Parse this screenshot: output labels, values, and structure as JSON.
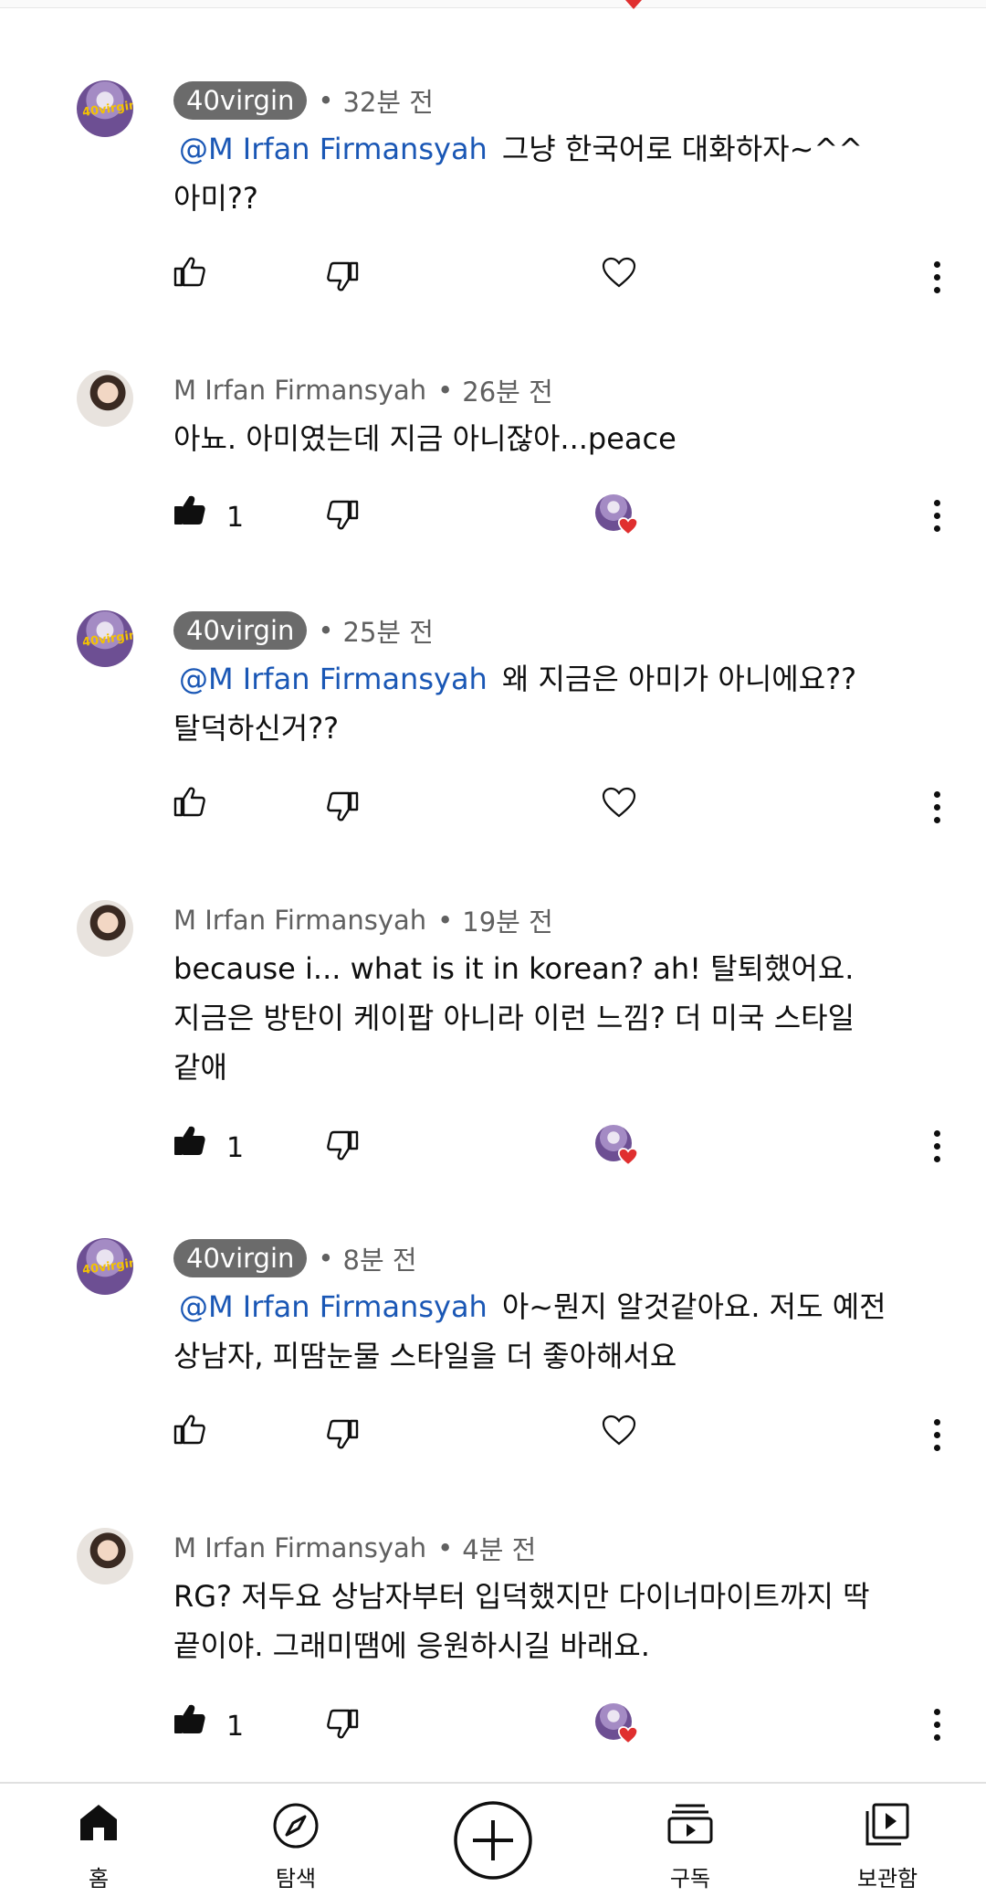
{
  "comments": [
    {
      "author": "40virgin",
      "author_style": "badge",
      "time": "32분 전",
      "mention": "@M Irfan Firmansyah",
      "text_line1": "그냥 한국어로 대화하자~^^",
      "text_line2": "아미??",
      "text_line3": "",
      "likes": "",
      "heart": "empty"
    },
    {
      "author": "M Irfan Firmansyah",
      "author_style": "plain",
      "time": "26분 전",
      "mention": "",
      "text_line1": "아뇨. 아미였는데 지금 아니잖아...peace",
      "text_line2": "",
      "text_line3": "",
      "likes": "1",
      "heart": "creator"
    },
    {
      "author": "40virgin",
      "author_style": "badge",
      "time": "25분 전",
      "mention": "@M Irfan Firmansyah",
      "text_line1": "왜 지금은 아미가 아니에요??",
      "text_line2": "탈덕하신거??",
      "text_line3": "",
      "likes": "",
      "heart": "empty"
    },
    {
      "author": "M Irfan Firmansyah",
      "author_style": "plain",
      "time": "19분 전",
      "mention": "",
      "text_line1": "because i... what is it in korean? ah! 탈퇴했어요.",
      "text_line2": "지금은 방탄이 케이팝 아니라 이런 느낌? 더 미국 스타일",
      "text_line3": "같애",
      "likes": "1",
      "heart": "creator"
    },
    {
      "author": "40virgin",
      "author_style": "badge",
      "time": "8분 전",
      "mention": "@M Irfan Firmansyah",
      "text_line1": "아~뭔지 알것같아요. 저도 예전",
      "text_line2": "상남자, 피땀눈물 스타일을 더 좋아해서요",
      "text_line3": "",
      "likes": "",
      "heart": "empty"
    },
    {
      "author": "M Irfan Firmansyah",
      "author_style": "plain",
      "time": "4분 전",
      "mention": "",
      "text_line1": "RG? 저두요 상남자부터 입덕했지만 다이너마이트까지 딱",
      "text_line2": "끝이야. 그래미땜에 응원하시길 바래요.",
      "text_line3": "",
      "likes": "1",
      "heart": "creator"
    }
  ],
  "separator": "•",
  "avatar_text": "40virgin",
  "nav": {
    "home": "홈",
    "explore": "탐색",
    "subscriptions": "구독",
    "library": "보관함"
  },
  "colors": {
    "mention": "#1a57b5",
    "badge_bg": "#6b6b6b",
    "heart_red": "#e02f2f",
    "meta_gray": "#606060"
  }
}
